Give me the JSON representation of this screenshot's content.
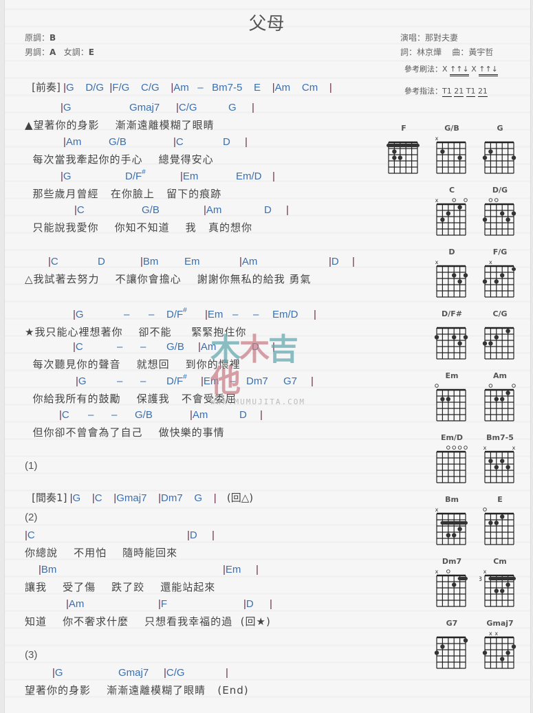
{
  "song": {
    "title": "父母",
    "original_key_label": "原調：",
    "original_key": "B",
    "male_key_label": "男調：",
    "male_key": "A",
    "female_key_label": "女調：",
    "female_key": "E",
    "singer_label": "演唱：",
    "singer": "那對夫妻",
    "lyricist_label": "詞：",
    "lyricist": "林京燁",
    "composer_label": "曲：",
    "composer": "黃宇哲",
    "strum_label": "參考刷法：",
    "strum_parts": [
      "X",
      "↑↑↓",
      "X",
      "↑↑↓"
    ],
    "finger_label": "參考指法：",
    "finger_parts": [
      "T1",
      "21",
      "T1",
      "21"
    ]
  },
  "intro": {
    "label": "[前奏]",
    "chords": "|G    D/G  |F/G    C/G    |Am   –   Bm7-5    E    |Am    Cm    |"
  },
  "verse": [
    {
      "chords": [
        [
          "|G",
          52
        ],
        [
          "Gmaj7",
          152
        ],
        [
          "|C/G",
          220
        ],
        [
          "G",
          296
        ],
        [
          "|",
          330
        ]
      ],
      "lyric": "▲望著你的身影    漸漸遠離模糊了眼睛"
    },
    {
      "chords": [
        [
          "|Am",
          56
        ],
        [
          "G/B",
          122
        ],
        [
          "|C",
          216
        ],
        [
          "D",
          288
        ],
        [
          "|",
          320
        ]
      ],
      "lyric": "  每次當我牽起你的手心    總覺得安心"
    },
    {
      "chords": [
        [
          "|G",
          52
        ],
        [
          "D/F#",
          146
        ],
        [
          "|Em",
          226
        ],
        [
          "Em/D",
          307
        ],
        [
          "|",
          360
        ]
      ],
      "lyric": "  那些歲月曾經   在你臉上   留下的痕跡"
    },
    {
      "chords": [
        [
          "|C",
          72
        ],
        [
          "G/B",
          170
        ],
        [
          "|Am",
          260
        ],
        [
          "D",
          348
        ],
        [
          "|",
          380
        ]
      ],
      "lyric": "  只能說我愛你    你知不知道    我   真的想你"
    }
  ],
  "pre_chorus": {
    "chords": [
      [
        "|C",
        34
      ],
      [
        "D",
        106
      ],
      [
        "|Bm",
        168
      ],
      [
        "Em",
        232
      ],
      [
        "|Am",
        312
      ],
      [
        "|D",
        442
      ],
      [
        "|",
        476
      ]
    ],
    "lyric": "△我試著去努力    不讓你會擔心    謝謝你無私的給我 勇氣"
  },
  "chorus": [
    {
      "chords": [
        [
          "|G",
          70
        ],
        [
          "–",
          144
        ],
        [
          "–",
          180
        ],
        [
          "D/F#",
          206
        ],
        [
          "|Em",
          262
        ],
        [
          "–",
          302
        ],
        [
          "–",
          332
        ],
        [
          "Em/D",
          360
        ],
        [
          "|",
          420
        ]
      ],
      "lyric": "★我只能心裡想著你    卻不能     緊緊抱住你"
    },
    {
      "chords": [
        [
          "|C",
          70
        ],
        [
          "–",
          134
        ],
        [
          "–",
          168
        ],
        [
          "G/B",
          206
        ],
        [
          "|Am",
          252
        ],
        [
          "D",
          330
        ],
        [
          "|",
          360
        ]
      ],
      "lyric": "  每次聽見你的聲音    就想回    到你的懷裡"
    },
    {
      "chords": [
        [
          "|G",
          74
        ],
        [
          "–",
          134
        ],
        [
          "–",
          168
        ],
        [
          "D/F#",
          206
        ],
        [
          "|Em",
          256
        ],
        [
          "–",
          298
        ],
        [
          "Dm7",
          322
        ],
        [
          "G7",
          376
        ],
        [
          "|",
          416
        ]
      ],
      "lyric": "  你給我所有的鼓勵    保護我   不會受委屈"
    },
    {
      "chords": [
        [
          "|C",
          50
        ],
        [
          "–",
          92
        ],
        [
          "–",
          126
        ],
        [
          "G/B",
          160
        ],
        [
          "|Am",
          240
        ],
        [
          "D",
          312
        ],
        [
          "|",
          342
        ]
      ],
      "lyric": "  但你卻不曾會為了自己    做快樂的事情"
    }
  ],
  "section1": {
    "marker": "(1)",
    "label": "[間奏1]",
    "chords": " |G    |C    |Gmaj7    |Dm7    G    |",
    "repeat": "(回△)"
  },
  "section2": {
    "marker": "(2)",
    "lines": [
      {
        "chords": [
          [
            "|C",
            0
          ],
          [
            "|D",
            236
          ],
          [
            "|",
            272
          ]
        ],
        "lyric": "你總說    不用怕    隨時能回來"
      },
      {
        "chords": [
          [
            "|Bm",
            20
          ],
          [
            "|Em",
            288
          ],
          [
            "|",
            336
          ]
        ],
        "lyric": "讓我    受了傷    跌了跤    還能站起來"
      },
      {
        "chords": [
          [
            "|Am",
            60
          ],
          [
            "|F",
            194
          ],
          [
            "|D",
            318
          ],
          [
            "|",
            356
          ]
        ],
        "lyric": "知道    你不奢求什麼    只想看我幸福的過  (回★)"
      }
    ]
  },
  "section3": {
    "marker": "(3)",
    "chords": [
      [
        "|G",
        40
      ],
      [
        "Gmaj7",
        136
      ],
      [
        "|C/G",
        202
      ],
      [
        "|",
        292
      ]
    ],
    "lyric": "望著你的身影    漸漸遠離模糊了眼睛   (End)"
  },
  "watermark": {
    "brand": "木木吉他",
    "url": "WWW.MUMUJITA.COM"
  },
  "chord_diagrams": [
    {
      "name": "F",
      "top": "",
      "barre": [
        1,
        0,
        5
      ],
      "dots": [
        [
          2,
          1
        ],
        [
          3,
          1
        ],
        [
          3,
          2
        ]
      ],
      "base": ""
    },
    {
      "name": "G/B",
      "top": "x-----",
      "barre": null,
      "dots": [
        [
          2,
          1
        ],
        [
          3,
          4
        ]
      ],
      "base": ""
    },
    {
      "name": "G",
      "top": "",
      "barre": null,
      "dots": [
        [
          3,
          0
        ],
        [
          2,
          1
        ],
        [
          3,
          5
        ]
      ],
      "base": ""
    },
    {
      "name": "C",
      "top": "x--o-o",
      "barre": null,
      "dots": [
        [
          3,
          1
        ],
        [
          2,
          2
        ],
        [
          1,
          4
        ]
      ],
      "base": ""
    },
    {
      "name": "D/G",
      "top": "-oo---",
      "barre": null,
      "dots": [
        [
          3,
          0
        ],
        [
          2,
          3
        ],
        [
          3,
          4
        ],
        [
          2,
          5
        ]
      ],
      "base": ""
    },
    {
      "name": "D",
      "top": "x-----",
      "barre": null,
      "dots": [
        [
          2,
          3
        ],
        [
          3,
          4
        ],
        [
          2,
          5
        ]
      ],
      "base": ""
    },
    {
      "name": "F/G",
      "top": "-x----",
      "barre": [
        1,
        5,
        5
      ],
      "dots": [
        [
          3,
          0
        ],
        [
          3,
          2
        ],
        [
          2,
          3
        ]
      ],
      "base": ""
    },
    {
      "name": "D/F#",
      "top": "",
      "barre": null,
      "dots": [
        [
          2,
          0
        ],
        [
          2,
          3
        ],
        [
          3,
          4
        ],
        [
          2,
          5
        ]
      ],
      "base": ""
    },
    {
      "name": "C/G",
      "top": "",
      "barre": null,
      "dots": [
        [
          3,
          0
        ],
        [
          3,
          1
        ],
        [
          2,
          2
        ],
        [
          1,
          4
        ]
      ],
      "base": ""
    },
    {
      "name": "Em",
      "top": "o-----",
      "barre": null,
      "dots": [
        [
          2,
          1
        ],
        [
          2,
          2
        ]
      ],
      "base": ""
    },
    {
      "name": "Am",
      "top": "-o---o",
      "barre": null,
      "dots": [
        [
          2,
          2
        ],
        [
          2,
          3
        ],
        [
          1,
          4
        ]
      ],
      "base": ""
    },
    {
      "name": "Em/D",
      "top": "--oooo",
      "barre": null,
      "dots": [],
      "base": ""
    },
    {
      "name": "Bm7-5",
      "top": "x----x",
      "barre": null,
      "dots": [
        [
          2,
          1
        ],
        [
          3,
          2
        ],
        [
          2,
          3
        ],
        [
          3,
          4
        ]
      ],
      "base": ""
    },
    {
      "name": "Bm",
      "top": "x-----",
      "barre": [
        2,
        1,
        5
      ],
      "dots": [
        [
          3,
          4
        ],
        [
          4,
          2
        ],
        [
          4,
          3
        ]
      ],
      "base": ""
    },
    {
      "name": "E",
      "top": "o-----",
      "barre": null,
      "dots": [
        [
          2,
          1
        ],
        [
          2,
          2
        ],
        [
          1,
          3
        ]
      ],
      "base": ""
    },
    {
      "name": "Dm7",
      "top": "x-o---",
      "barre": [
        1,
        4,
        5
      ],
      "dots": [
        [
          2,
          3
        ]
      ],
      "base": ""
    },
    {
      "name": "Cm",
      "top": "x-----",
      "barre": [
        1,
        1,
        5
      ],
      "dots": [
        [
          2,
          4
        ],
        [
          3,
          2
        ],
        [
          3,
          3
        ]
      ],
      "base": "3"
    },
    {
      "name": "G7",
      "top": "",
      "barre": null,
      "dots": [
        [
          3,
          0
        ],
        [
          2,
          1
        ],
        [
          1,
          5
        ]
      ],
      "base": ""
    },
    {
      "name": "Gmaj7",
      "top": "-xx---",
      "barre": null,
      "dots": [
        [
          3,
          0
        ],
        [
          4,
          3
        ],
        [
          3,
          4
        ],
        [
          2,
          5
        ]
      ],
      "base": ""
    }
  ]
}
